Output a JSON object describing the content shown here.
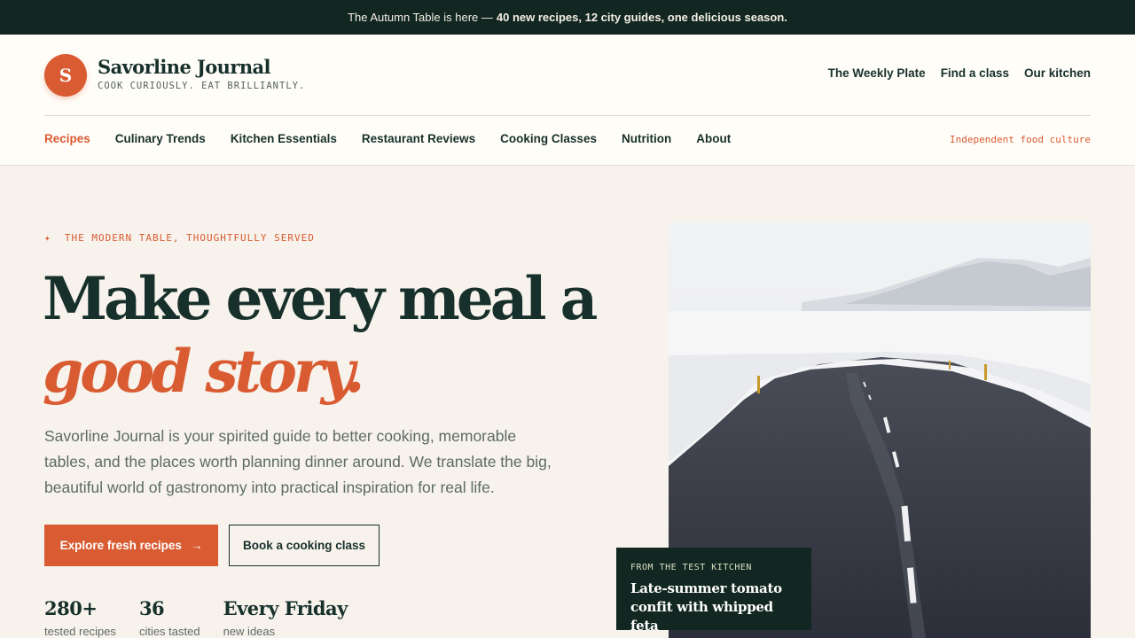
{
  "announcement": {
    "lead": "The Autumn Table is here —",
    "highlight": "40 new recipes, 12 city guides, one delicious season."
  },
  "brand": {
    "logo_letter": "S",
    "name": "Savorline Journal",
    "tagline": "COOK CURIOUSLY. EAT BRILLIANTLY."
  },
  "utility_nav": [
    "The Weekly Plate",
    "Find a class",
    "Our kitchen"
  ],
  "main_nav": {
    "items": [
      "Recipes",
      "Culinary Trends",
      "Kitchen Essentials",
      "Restaurant Reviews",
      "Cooking Classes",
      "Nutrition",
      "About"
    ],
    "active": "Recipes",
    "note": "Independent food culture"
  },
  "hero": {
    "eyebrow_icon": "sparkle-icon",
    "eyebrow": "THE MODERN TABLE, THOUGHTFULLY SERVED",
    "title_line1": "Make every meal a",
    "title_line2": "good story.",
    "description": "Savorline Journal is your spirited guide to better cooking, memorable tables, and the places worth planning dinner around. We translate the big, beautiful world of gastronomy into practical inspiration for real life.",
    "primary_cta": "Explore fresh recipes",
    "primary_cta_icon": "arrow-right-icon",
    "secondary_cta": "Book a cooking class",
    "stats": [
      {
        "value": "280+",
        "label": "tested recipes"
      },
      {
        "value": "36",
        "label": "cities tasted"
      },
      {
        "value": "Every Friday",
        "label": "new ideas"
      }
    ]
  },
  "feature_card": {
    "eyebrow": "FROM THE TEST KITCHEN",
    "title": "Late-summer tomato confit with whipped feta"
  },
  "colors": {
    "accent": "#d95b32",
    "dark": "#122721",
    "text": "#17302b",
    "background": "#f7f2eb"
  }
}
